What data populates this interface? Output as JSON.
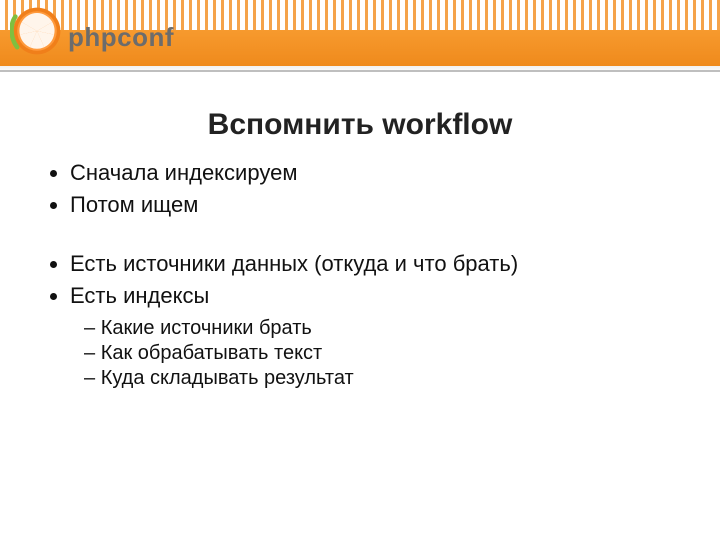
{
  "brand": {
    "logo_text": "phpconf"
  },
  "title": "Вспомнить workflow",
  "bullets_group_1": [
    "Сначала индексируем",
    "Потом ищем"
  ],
  "bullets_group_2": [
    "Есть источники данных (откуда и что брать)",
    "Есть индексы"
  ],
  "sub_bullets": [
    "Какие источники брать",
    "Как обрабатывать текст",
    "Куда складывать результат"
  ]
}
